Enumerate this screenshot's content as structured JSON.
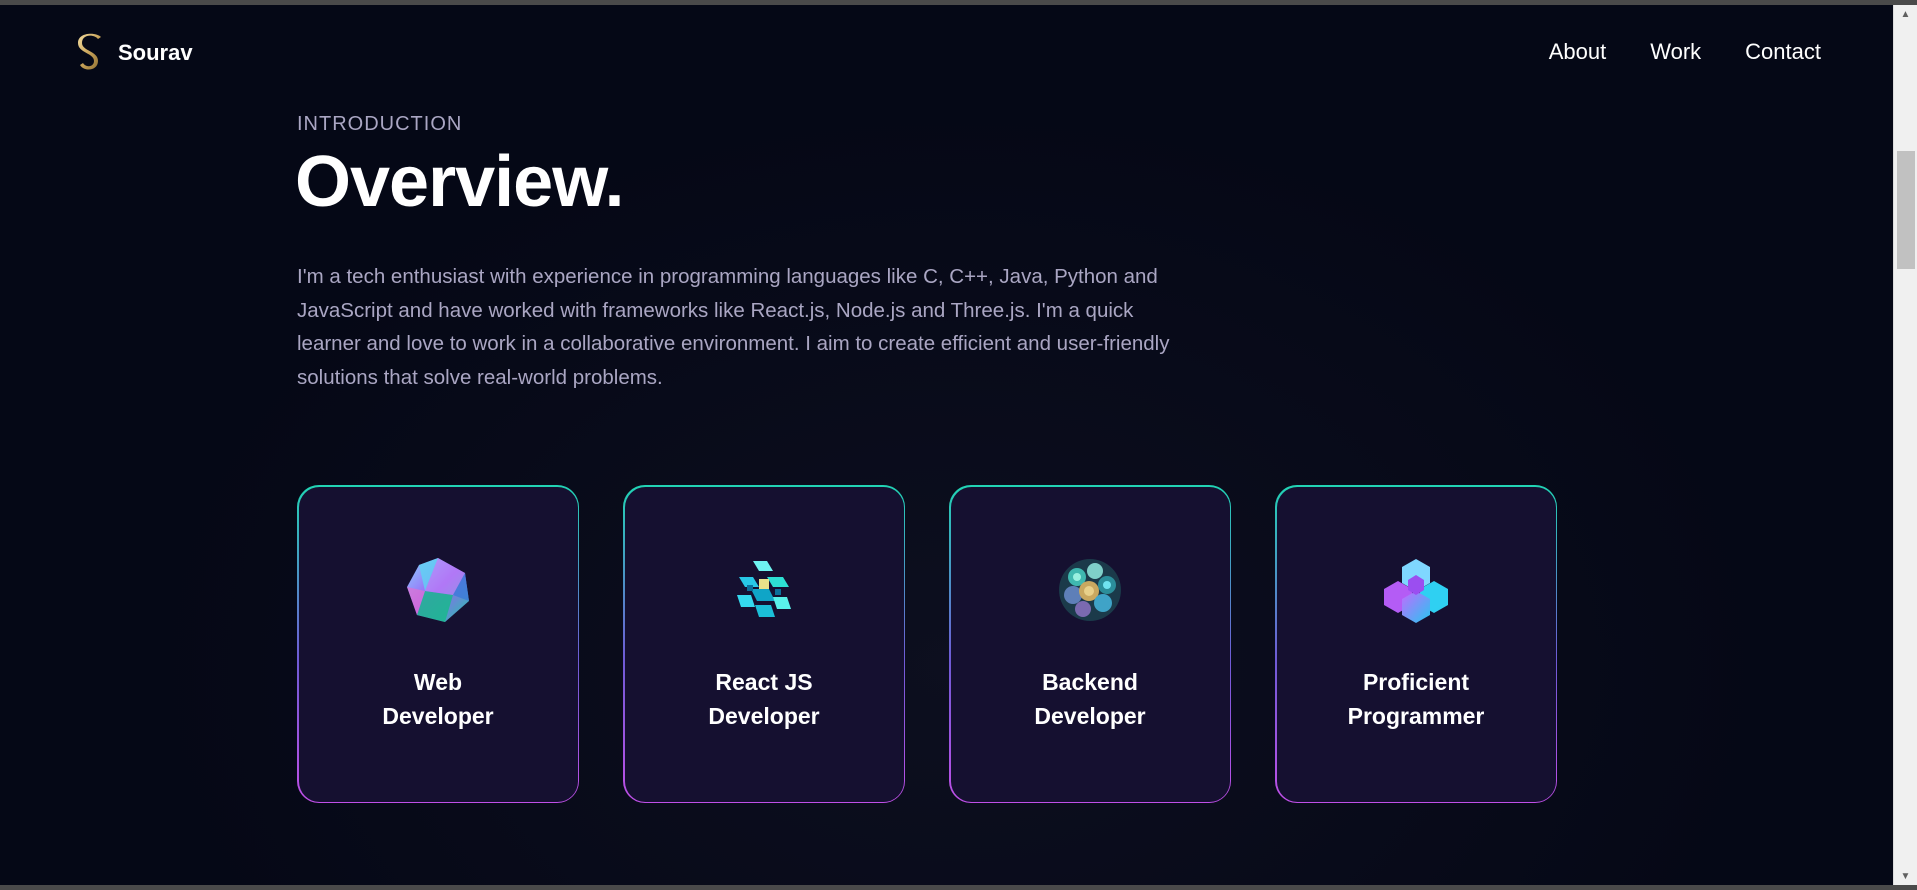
{
  "nav": {
    "logo_text": "Sourav",
    "logo_letter": "S",
    "links": [
      "About",
      "Work",
      "Contact"
    ]
  },
  "intro": {
    "eyebrow": "INTRODUCTION",
    "title": "Overview.",
    "description": "I'm a tech enthusiast with experience in programming languages like C, C++, Java, Python and JavaScript and have worked with frameworks like React.js, Node.js and Three.js. I'm a quick learner and love to work in a collaborative environment. I aim to create efficient and user-friendly solutions that solve real-world problems."
  },
  "cards": [
    {
      "title": "Web\nDeveloper",
      "icon": "polyhedron-icon"
    },
    {
      "title": "React JS\nDeveloper",
      "icon": "cube-cluster-icon"
    },
    {
      "title": "Backend\nDeveloper",
      "icon": "sphere-cluster-icon"
    },
    {
      "title": "Proficient\nProgrammer",
      "icon": "hexagon-cluster-icon"
    }
  ],
  "colors": {
    "background": "#050816",
    "card_background": "#151030",
    "secondary_text": "#aaa6c3",
    "border_top": "#21d4b4",
    "border_bottom": "#c04fe8"
  }
}
